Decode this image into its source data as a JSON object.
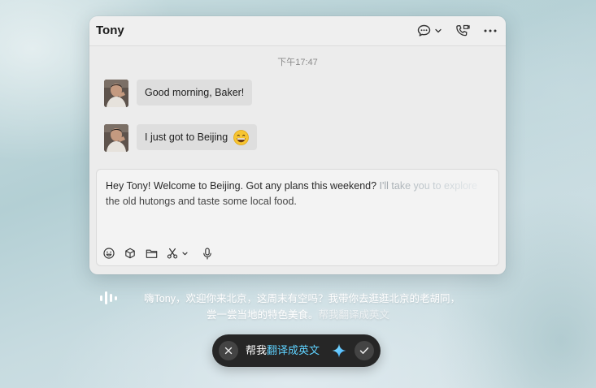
{
  "chat": {
    "contact_name": "Tony",
    "header_icons": [
      "chat-bubble-icon",
      "chevron-down-icon",
      "phone-icon",
      "more-icon"
    ],
    "timestamp": "下午17:47",
    "messages": [
      {
        "text": "Good morning, Baker!",
        "emoji": ""
      },
      {
        "text": "I just got to Beijing",
        "emoji": "grinning-face-emoji"
      }
    ],
    "draft": {
      "line1_solid": "Hey Tony! Welcome to Beijing. Got any plans this weekend?",
      "line1_faded": " I'll take you to explore",
      "line2": "the old hutongs and taste some local food."
    },
    "toolbar_icons": [
      "emoji-icon",
      "cube-icon",
      "folder-icon",
      "scissors-icon",
      "chevron-down-icon",
      "microphone-icon"
    ]
  },
  "transcript": {
    "line1": "嗨Tony，欢迎你来北京，这周末有空吗？我带你去逛逛北京的老胡同，",
    "line2_main": "尝一尝当地的特色美食。",
    "line2_faint": "帮我翻译成英文"
  },
  "command_bar": {
    "prefix": "帮我",
    "highlight": "翻译成英文",
    "icons": [
      "close-icon",
      "sparkle-icon",
      "check-icon"
    ]
  },
  "colors": {
    "accent": "#5fd2ff",
    "pill_bg": "#262626",
    "window_bg": "#ececec"
  }
}
